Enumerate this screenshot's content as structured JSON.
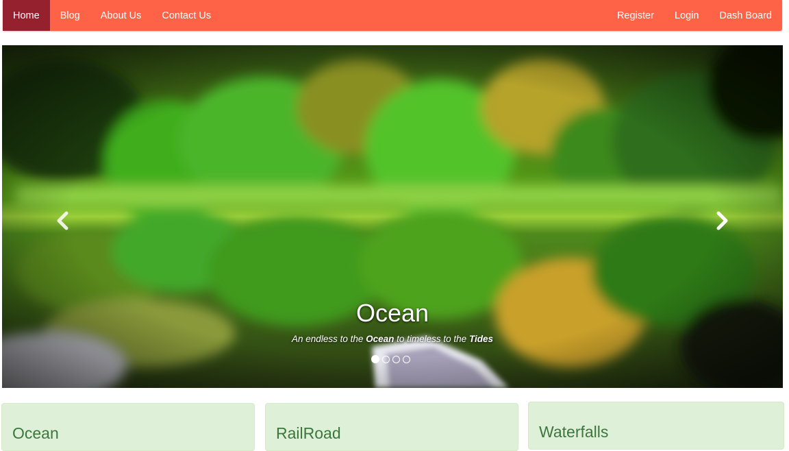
{
  "nav": {
    "left": [
      {
        "label": "Home",
        "active": true
      },
      {
        "label": "Blog"
      },
      {
        "label": "About Us"
      },
      {
        "label": "Contact Us"
      }
    ],
    "right": [
      {
        "label": "Register"
      },
      {
        "label": "Login"
      },
      {
        "label": "Dash Board"
      }
    ]
  },
  "carousel": {
    "caption_title": "Ocean",
    "caption_pre": "An endless to the ",
    "caption_b1": "Ocean",
    "caption_mid": " to timeless to the ",
    "caption_b2": "Tides",
    "slide_count": 4,
    "active_slide": 1
  },
  "panels": [
    {
      "title": "Ocean"
    },
    {
      "title": "RailRoad"
    },
    {
      "title": "Waterfalls"
    }
  ],
  "colors": {
    "navbar": "#ff6347",
    "nav_active": "#96212e",
    "panel_bg": "#dff0d8",
    "panel_text": "#3c763d"
  }
}
